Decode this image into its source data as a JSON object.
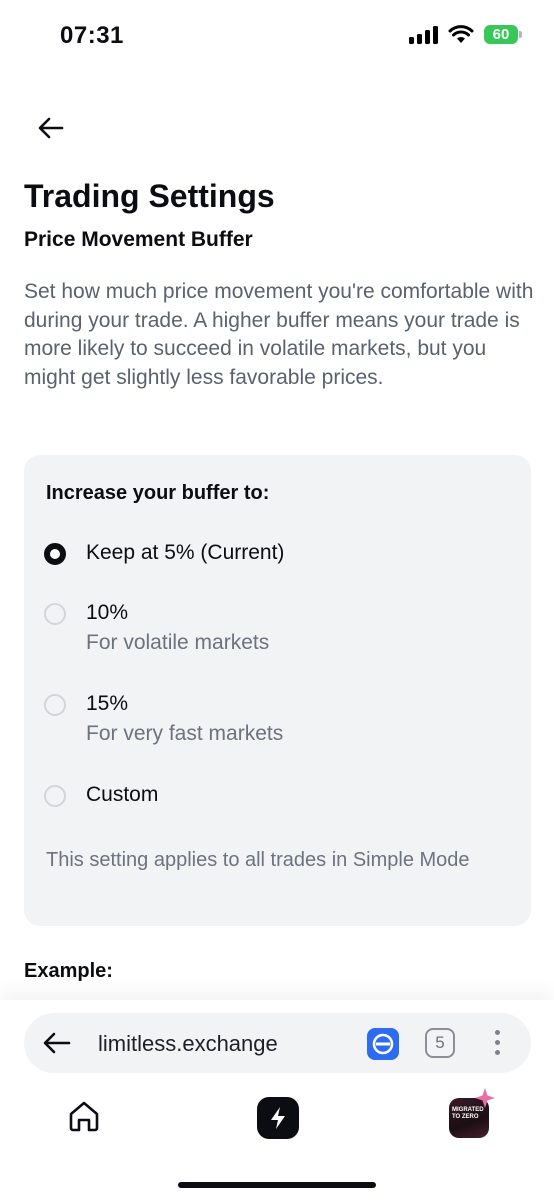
{
  "status_bar": {
    "time": "07:31",
    "battery": "60",
    "icons": [
      "signal-icon",
      "wifi-icon",
      "battery-charging-icon"
    ]
  },
  "header": {
    "back_icon": "arrow-left-icon",
    "title": "Trading Settings",
    "subtitle": "Price Movement Buffer",
    "description": "Set how much price movement you're comfortable with during your trade. A higher buffer means your trade is more likely to succeed in volatile markets, but you might get slightly less favorable prices."
  },
  "buffer_card": {
    "heading": "Increase your buffer to:",
    "options": [
      {
        "label": "Keep at 5% (Current)",
        "sublabel": "",
        "selected": true
      },
      {
        "label": "10%",
        "sublabel": "For volatile markets",
        "selected": false
      },
      {
        "label": "15%",
        "sublabel": "For very fast markets",
        "selected": false
      },
      {
        "label": "Custom",
        "sublabel": "",
        "selected": false
      }
    ],
    "note": "This setting applies to all trades in Simple Mode"
  },
  "example": {
    "label": "Example:"
  },
  "browser": {
    "url": "limitless.exchange",
    "tab_count": "5",
    "icons": [
      "arrow-left-icon",
      "extension-icon",
      "tabs-icon",
      "more-vertical-icon"
    ]
  },
  "bottom_nav": {
    "avatar_text": "MIGRATED TO ZERO",
    "icons": [
      "home-icon",
      "bolt-icon",
      "avatar-icon"
    ]
  },
  "colors": {
    "text": "#0b0d12",
    "muted": "#6b7280",
    "card_bg": "#f2f3f5",
    "battery": "#38c759",
    "extension": "#2d6bf0"
  }
}
